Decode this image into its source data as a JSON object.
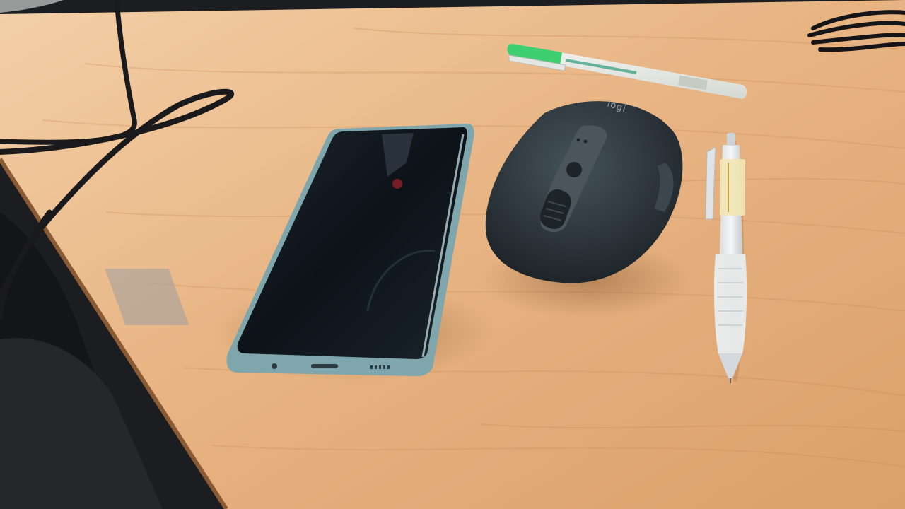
{
  "scene": {
    "description_free": true,
    "objects": {
      "phone": {
        "icon": "smartphone-icon"
      },
      "mouse": {
        "icon": "computer-mouse-icon",
        "brand_text": "logi"
      },
      "gel_pen": {
        "icon": "pen-icon",
        "accent": "#3fcf72"
      },
      "mechanical_pencil": {
        "icon": "pencil-icon"
      },
      "cables": {
        "icon": "cable-icon"
      }
    }
  },
  "colors": {
    "desk_light": "#f0c79b",
    "desk_mid": "#e3ad79",
    "desk_dark": "#c98a57",
    "floor": "#1c1d20",
    "phone_body": "#121820",
    "phone_frame": "#7fa6ad",
    "mouse_body": "#2b3338",
    "mouse_highlight": "#4a565c",
    "cable": "#1a1a1c"
  }
}
